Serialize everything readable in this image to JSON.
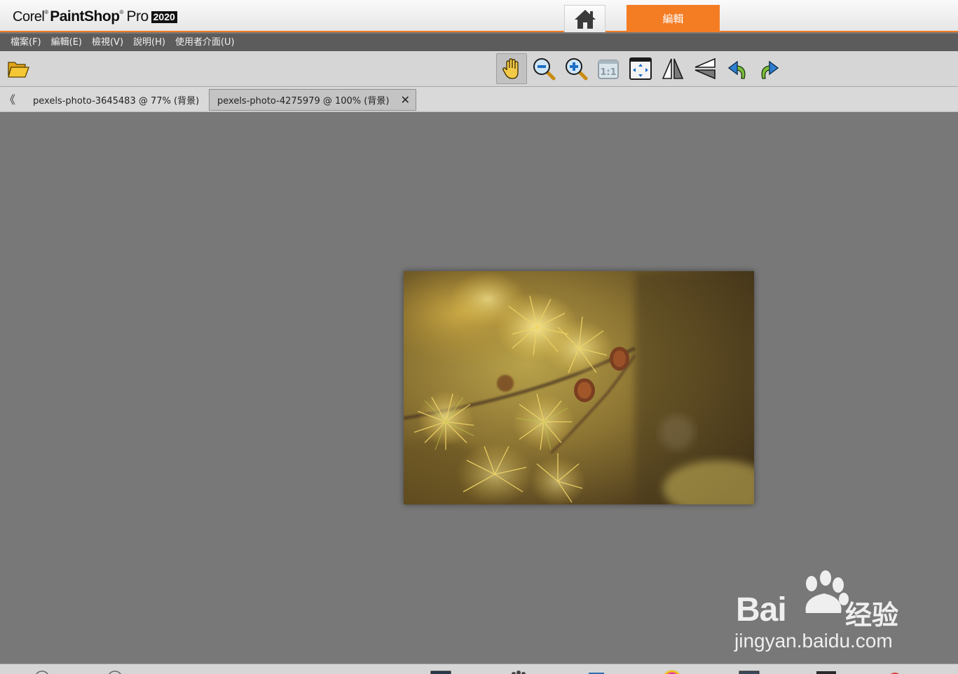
{
  "titlebar": {
    "brand_corel": "Corel",
    "brand_paintshop": "PaintShop",
    "brand_pro": "Pro",
    "brand_year": "2020",
    "edit_tab_label": "編輯",
    "accent_color": "#f47c23"
  },
  "menu": {
    "items": [
      "檔案(F)",
      "編輯(E)",
      "檢視(V)",
      "說明(H)",
      "使用者介面(U)"
    ]
  },
  "toolbar": {
    "icons": [
      "open-folder-icon",
      "pan-hand-icon",
      "zoom-out-icon",
      "zoom-in-icon",
      "actual-size-icon",
      "fit-window-icon",
      "flip-icon",
      "mirror-icon",
      "rotate-left-icon",
      "rotate-right-icon"
    ],
    "actual_size_label": "1:1"
  },
  "tabs": [
    {
      "label": "pexels-photo-3645483 @  77% (背景)"
    },
    {
      "label": "pexels-photo-4275979 @ 100% (背景)"
    }
  ],
  "tab_close": "✕",
  "tab_scroll": "《",
  "watermark": {
    "main": "Bai",
    "du": "du",
    "cn": "经验",
    "url": "jingyan.baidu.com"
  }
}
